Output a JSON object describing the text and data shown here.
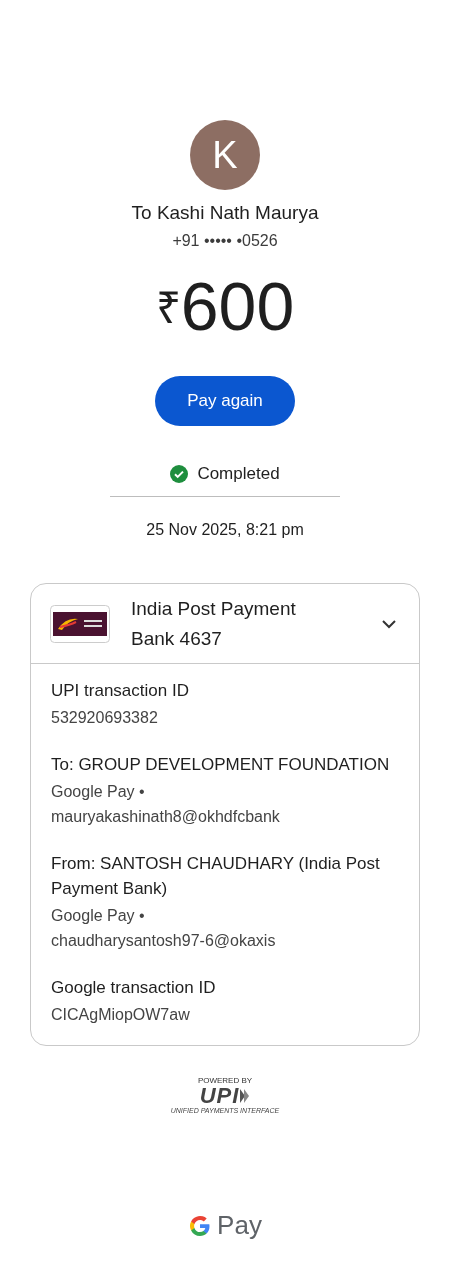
{
  "payee": {
    "initial": "K",
    "name": "To Kashi Nath Maurya",
    "phone": "+91 ••••• •0526"
  },
  "amount": {
    "currency": "₹",
    "value": "600"
  },
  "pay_again_button": "Pay again",
  "status": {
    "label": "Completed",
    "completed": true
  },
  "date": "25 Nov 2025, 8:21 pm",
  "account": {
    "name": "India Post Payment Bank 4637",
    "expanded": true
  },
  "details": [
    {
      "label": "UPI transaction ID",
      "lines": [
        "532920693382"
      ]
    },
    {
      "label": "To: GROUP DEVELOPMENT FOUNDATION",
      "lines": [
        "Google Pay •",
        "mauryakashinath8@okhdfcbank"
      ]
    },
    {
      "label": "From: SANTOSH CHAUDHARY (India Post Payment Bank)",
      "lines": [
        "Google Pay •",
        "chaudharysantosh97-6@okaxis"
      ]
    },
    {
      "label": "Google transaction ID",
      "lines": [
        "CICAgMiopOW7aw"
      ]
    }
  ],
  "upi_badge": {
    "caption": "POWERED BY",
    "mark": "UPI",
    "subtitle": "UNIFIED PAYMENTS INTERFACE"
  },
  "footer": {
    "brand": "Pay"
  }
}
